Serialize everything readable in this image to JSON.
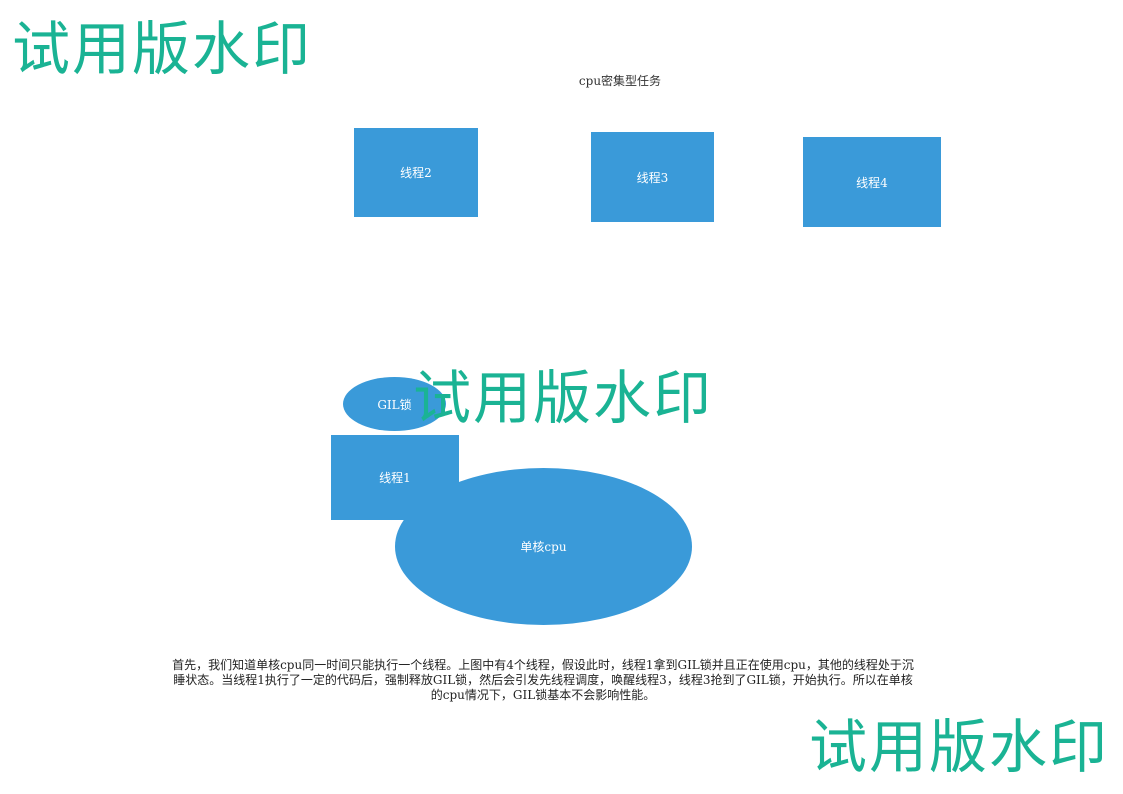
{
  "colors": {
    "shape_fill": "#3a9ad9",
    "watermark": "#1ab394",
    "shape_text": "#ffffff"
  },
  "watermark_text": "试用版水印",
  "diagram": {
    "title": "cpu密集型任务",
    "threads": {
      "t1": "线程1",
      "t2": "线程2",
      "t3": "线程3",
      "t4": "线程4"
    },
    "gil_lock": "GIL锁",
    "cpu": "单核cpu"
  },
  "description": "首先，我们知道单核cpu同一时间只能执行一个线程。上图中有4个线程，假设此时，线程1拿到GIL锁并且正在使用cpu，其他的线程处于沉睡状态。当线程1执行了一定的代码后，强制释放GIL锁，然后会引发先线程调度，唤醒线程3，线程3抢到了GIL锁，开始执行。所以在单核的cpu情况下，GIL锁基本不会影响性能。"
}
